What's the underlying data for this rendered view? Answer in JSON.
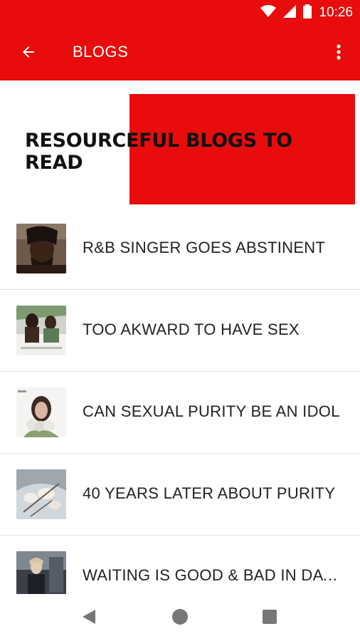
{
  "status_bar": {
    "time": "10:26",
    "icons": [
      "wifi-icon",
      "signal-icon",
      "battery-icon"
    ]
  },
  "app_bar": {
    "title": "BLOGS",
    "back_icon": "arrow-left-icon",
    "menu_icon": "more-vert-icon"
  },
  "banner": {
    "title": "RESOURCEFUL BLOGS TO READ"
  },
  "blogs": [
    {
      "title": "R&B SINGER GOES ABSTINENT"
    },
    {
      "title": "TOO AKWARD TO HAVE SEX"
    },
    {
      "title": "CAN SEXUAL PURITY BE AN IDOL"
    },
    {
      "title": "40 YEARS LATER ABOUT PURITY"
    },
    {
      "title": "WAITING IS GOOD & BAD IN DATING"
    }
  ],
  "nav_bar": {
    "icons": [
      "nav-back-icon",
      "nav-home-icon",
      "nav-recents-icon"
    ]
  },
  "colors": {
    "primary": "#e80c0c",
    "text": "#222222"
  }
}
